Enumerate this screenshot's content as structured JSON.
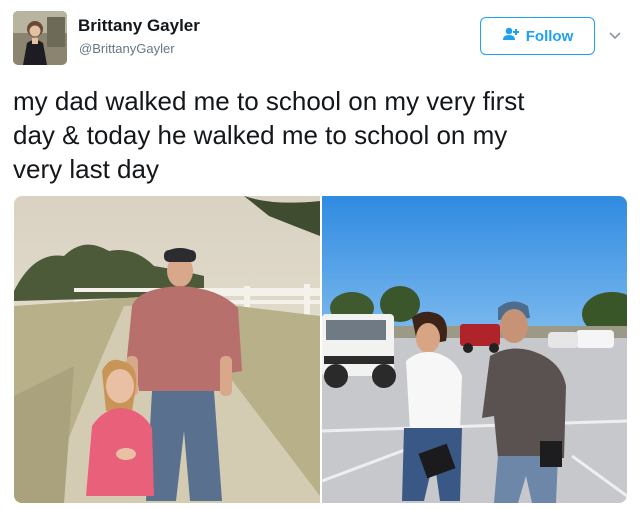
{
  "author": {
    "display_name": "Brittany Gayler",
    "handle": "@BrittanyGayler",
    "avatar_icon": "profile-photo"
  },
  "actions": {
    "follow_label": "Follow",
    "follow_icon": "add-user-icon",
    "menu_icon": "chevron-down-icon"
  },
  "tweet": {
    "text_lines": [
      "my dad walked me to school on my very first",
      "day & today he walked me to school on my",
      "very last day"
    ]
  },
  "media": [
    {
      "id": "first-day-photo"
    },
    {
      "id": "last-day-photo"
    }
  ],
  "colors": {
    "accent": "#1da1f2",
    "text": "#14171a",
    "muted": "#657786"
  }
}
